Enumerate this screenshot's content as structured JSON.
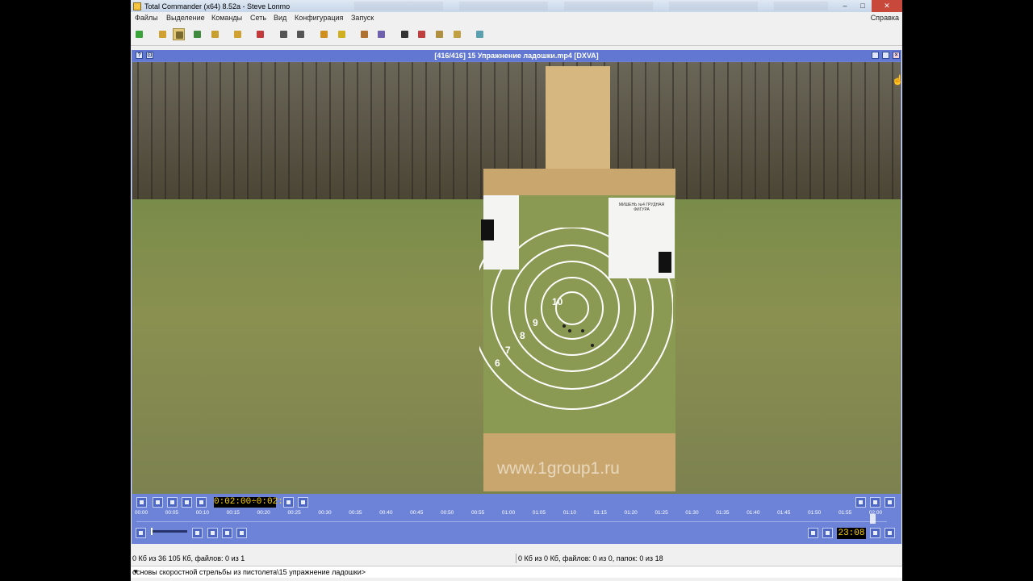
{
  "window": {
    "title": "Total Commander (x64) 8.52a - Steve Lonmo",
    "minimize": "–",
    "maximize": "□",
    "close": "✕"
  },
  "menu": {
    "items": [
      "Файлы",
      "Выделение",
      "Команды",
      "Сеть",
      "Вид",
      "Конфигурация",
      "Запуск"
    ],
    "help": "Справка"
  },
  "toolbar": {
    "icons": [
      "refresh-icon",
      "brief-view-icon",
      "thumbnails-view-icon",
      "image-view-icon",
      "tree-view-icon",
      "sync-icon",
      "unpack-icon",
      "back-icon",
      "forward-icon",
      "pack-icon",
      "archive-icon",
      "multi-rename-icon",
      "compare-icon",
      "find-files-icon",
      "cleanup-icon",
      "split-icon",
      "notepad-icon",
      "help-icon"
    ]
  },
  "viewer": {
    "title": "[416/416] 15 Упражнение ладошки.mp4 [DXVA]",
    "left_btn1": "?",
    "left_btn2": "⊡"
  },
  "video": {
    "watermark": "www.1group1.ru",
    "target_numbers": [
      "10",
      "9",
      "8",
      "7",
      "6"
    ],
    "paper_label": "МИШЕНЬ №4 ГРУДНАЯ ФИГУРА"
  },
  "player": {
    "time": "0:02:00÷0:02:02",
    "timeline_ticks": [
      "00:00",
      "00:05",
      "00:10",
      "00:15",
      "00:20",
      "00:25",
      "00:30",
      "00:35",
      "00:40",
      "00:45",
      "00:50",
      "00:55",
      "01:00",
      "01:05",
      "01:10",
      "01:15",
      "01:20",
      "01:25",
      "01:30",
      "01:35",
      "01:40",
      "01:45",
      "01:50",
      "01:55",
      "02:00"
    ],
    "progress": 0.984,
    "volume": 0.0,
    "clock": "23:08"
  },
  "status": {
    "left": "0 Кб из 36 105 Кб, файлов: 0 из 1",
    "right": "0 Кб из 0 Кб, файлов: 0 из 0, папок: 0 из 18"
  },
  "command_line": {
    "text": "основы скоростной стрельбы из пистолета\\15 упражнение ладошки>",
    "dropdown": "▼"
  }
}
